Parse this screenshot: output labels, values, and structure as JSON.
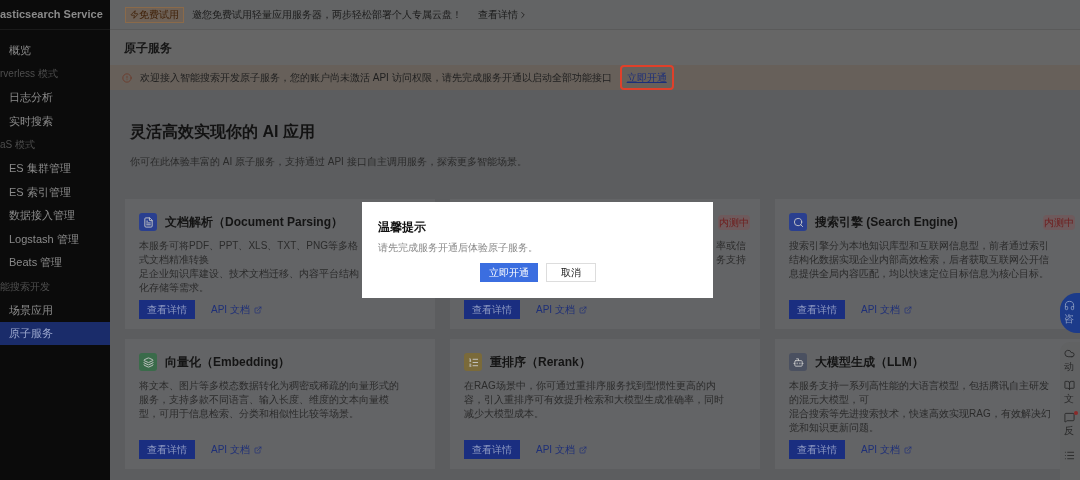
{
  "sidebar": {
    "title": "asticsearch Service",
    "items": [
      {
        "kind": "item",
        "label": "概览",
        "selected": false
      },
      {
        "kind": "section",
        "label": "rverless 模式"
      },
      {
        "kind": "item",
        "label": "日志分析",
        "selected": false
      },
      {
        "kind": "item",
        "label": "实时搜索",
        "selected": false
      },
      {
        "kind": "section",
        "label": "aS 模式"
      },
      {
        "kind": "item",
        "label": "ES 集群管理",
        "selected": false
      },
      {
        "kind": "item",
        "label": "ES 索引管理",
        "selected": false
      },
      {
        "kind": "item",
        "label": "数据接入管理",
        "selected": false
      },
      {
        "kind": "item",
        "label": "Logstash 管理",
        "selected": false
      },
      {
        "kind": "item",
        "label": "Beats 管理",
        "selected": false
      },
      {
        "kind": "section",
        "label": "能搜索开发"
      },
      {
        "kind": "item",
        "label": "场景应用",
        "selected": false
      },
      {
        "kind": "item",
        "label": "原子服务",
        "selected": true
      }
    ]
  },
  "banner": {
    "badge": "免费试用",
    "text": "邀您免费试用轻量应用服务器，两步轻松部署个人专属云盘！",
    "link": "查看详情"
  },
  "header": {
    "title": "原子服务"
  },
  "alert": {
    "text": "欢迎接入智能搜索开发原子服务，您的账户尚未激活 API 访问权限，请先完成服务开通以启动全部功能接口",
    "link": "立即开通",
    "highlighted": true
  },
  "hero": {
    "title": "灵活高效实现你的 AI 应用",
    "subtitle": "你可在此体验丰富的 AI 原子服务，支持通过 API 接口自主调用服务，探索更多智能场景。"
  },
  "cards": [
    {
      "kind": "left",
      "color": "#2a3f8f",
      "title": "文档解析（Document Parsing）",
      "lines": [
        "本服务可将PDF、PPT、XLS、TXT、PNG等多格式文档精准转换",
        "足企业知识库建设、技术文档迁移、内容平台结构化存储等需求。"
      ],
      "details": "查看详情",
      "docs": "API 文档"
    },
    {
      "kind": "covered",
      "badge": "内测中",
      "lines": [
        "率或信",
        "务支持"
      ],
      "details": "查看详情",
      "docs": "API 文档"
    },
    {
      "kind": "full",
      "color": "#2a3f8f",
      "title": "搜索引擎 (Search Engine)",
      "badge": "内测中",
      "lines": [
        "搜索引擎分为本地知识库型和互联网信息型，前者通过索引结构化数据实现企业内部高效检索，后者获取互联网公开信息提供全局内容匹配，均以快速定位目标信息为核心目标。"
      ],
      "details": "查看详情",
      "docs": "API 文档"
    },
    {
      "kind": "full",
      "color": "#3a6b4a",
      "title": "向量化（Embedding）",
      "lines": [
        "将文本、图片等多模态数据转化为稠密或稀疏的向量形式的服务，支持多款不同语言、输入长度、维度的文本向量模型，可用于信息检索、分类和相似性比较等场景。"
      ],
      "details": "查看详情",
      "docs": "API 文档"
    },
    {
      "kind": "full",
      "color": "#7a6a3a",
      "title": "重排序（Rerank）",
      "lines": [
        "在RAG场景中，你可通过重排序服务找到型惯性更高的内容，引入重排序可有效提升检索和大模型生成准确率，同时减少大模型成本。"
      ],
      "details": "查看详情",
      "docs": "API 文档"
    },
    {
      "kind": "full",
      "color": "#4a5060",
      "title": "大模型生成（LLM）",
      "lines": [
        "本服务支持一系列高性能的大语言模型，包括腾讯自主研发的混元大模型，可",
        "混合搜索等先进搜索技术，快速高效实现RAG，有效解决幻觉和知识更新问题。"
      ],
      "details": "查看详情",
      "docs": "API 文档"
    }
  ],
  "modal": {
    "title": "温馨提示",
    "message": "请先完成服务开通后体验原子服务。",
    "confirm": "立即开通",
    "cancel": "取消"
  },
  "float_tools": {
    "consult": "咨",
    "items": [
      {
        "label": "动",
        "dot": false
      },
      {
        "label": "文",
        "dot": false
      },
      {
        "label": "反",
        "dot": true
      }
    ]
  }
}
